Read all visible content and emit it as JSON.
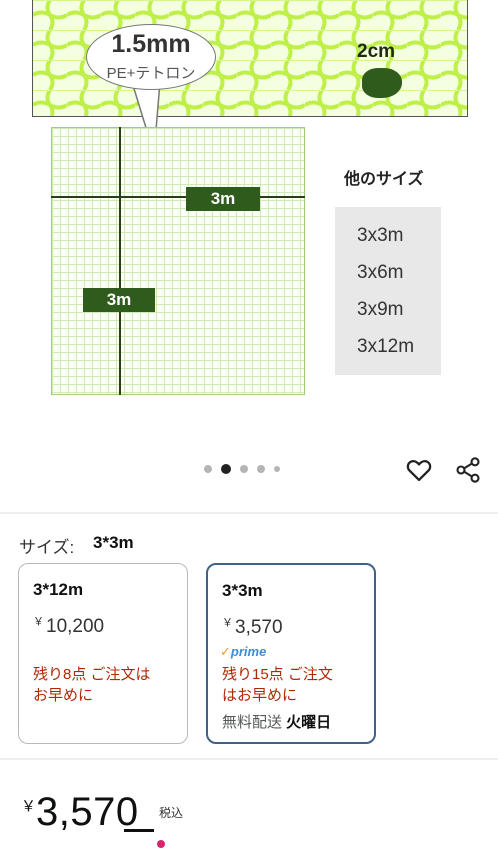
{
  "product_image": {
    "bubble_title": "1.5mm",
    "bubble_sub": "PE+テトロン",
    "hole_label": "2cm",
    "grid_tag_h": "3m",
    "grid_tag_v": "3m",
    "other_sizes_title": "他のサイズ",
    "other_sizes": [
      "3x3m",
      "3x6m",
      "3x9m",
      "3x12m"
    ],
    "colors": {
      "net": "#c6f25b",
      "tag": "#2f5b1c"
    }
  },
  "carousel": {
    "count": 5,
    "active_index": 1
  },
  "actions": {
    "favorite_icon": "heart-icon",
    "share_icon": "share-icon"
  },
  "size_selector": {
    "label": "サイズ:",
    "selected": "3*3m",
    "options": [
      {
        "name": "3*12m",
        "currency": "￥",
        "price": "10,200",
        "stock_line1": "残り8点 ご注文は",
        "stock_line2": "お早めに",
        "selected": false
      },
      {
        "name": "3*3m",
        "currency": "￥",
        "price": "3,570",
        "prime": "prime",
        "stock_line1": "残り15点 ご注文",
        "stock_line2": "はお早めに",
        "delivery_prefix": "無料配送 ",
        "delivery_day": "火曜日",
        "selected": true
      }
    ]
  },
  "price": {
    "currency": "￥",
    "amount": "3,570",
    "tax_note": "税込"
  }
}
